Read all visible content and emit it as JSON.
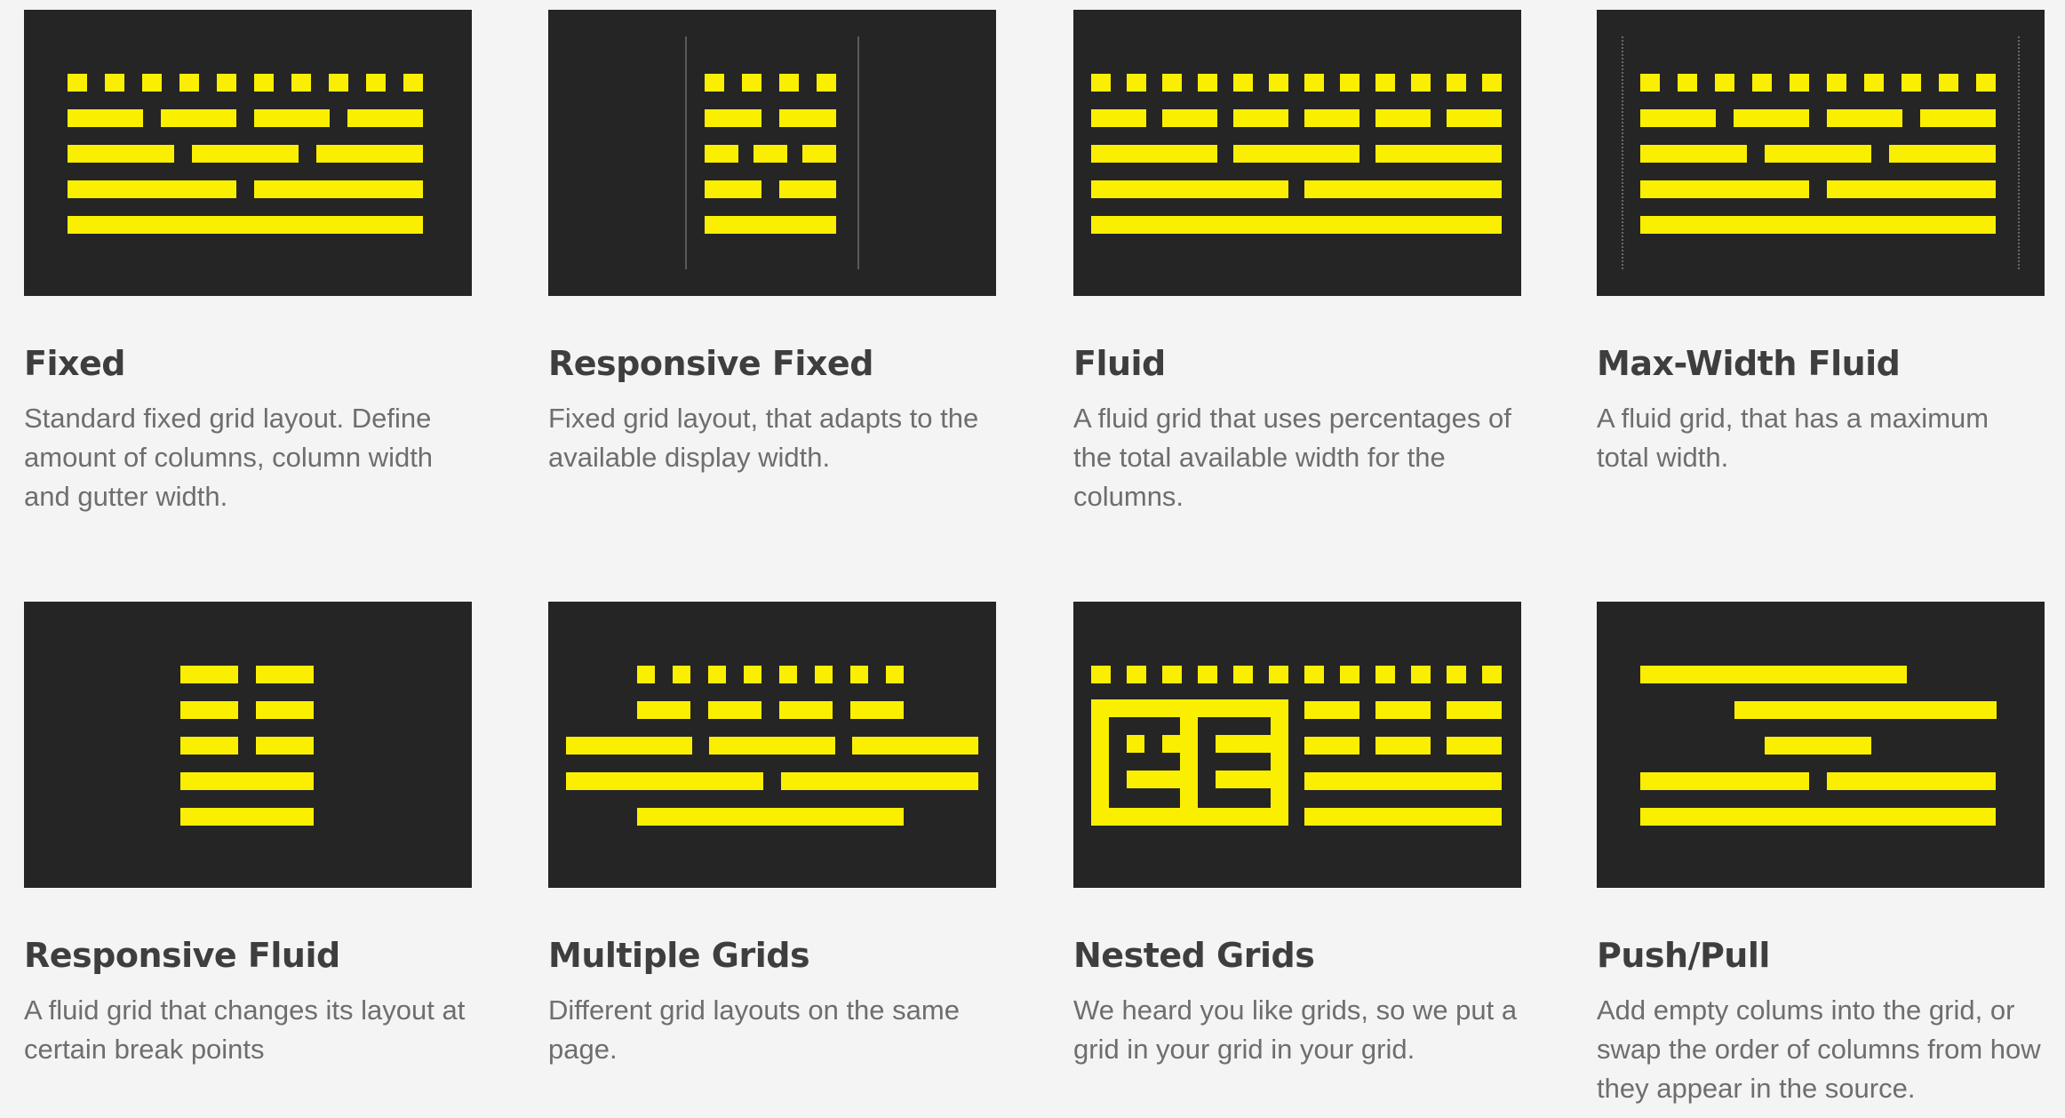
{
  "accent_color": "#fbef00",
  "thumbnail_background": "#252525",
  "cards": [
    {
      "title": "Fixed",
      "description": "Standard fixed grid layout. Define amount of columns, column width and gutter width.",
      "illustration": "fixed-grid-diagram"
    },
    {
      "title": "Responsive Fixed",
      "description": "Fixed grid layout, that adapts to the available display width.",
      "illustration": "responsive-fixed-grid-diagram"
    },
    {
      "title": "Fluid",
      "description": "A fluid grid that uses percentages of the total available width for the columns.",
      "illustration": "fluid-grid-diagram"
    },
    {
      "title": "Max-Width Fluid",
      "description": "A fluid grid, that has a maximum total width.",
      "illustration": "max-width-fluid-grid-diagram"
    },
    {
      "title": "Responsive Fluid",
      "description": "A fluid grid that changes its layout at certain break points",
      "illustration": "responsive-fluid-grid-diagram"
    },
    {
      "title": "Multiple Grids",
      "description": "Different grid layouts on the same page.",
      "illustration": "multiple-grids-diagram"
    },
    {
      "title": "Nested Grids",
      "description": "We heard you like grids, so we put a grid in your grid in your grid.",
      "illustration": "nested-grids-diagram"
    },
    {
      "title": "Push/Pull",
      "description": "Add empty colums into the grid, or swap the order of columns from how they appear in the source.",
      "illustration": "push-pull-grid-diagram"
    }
  ]
}
